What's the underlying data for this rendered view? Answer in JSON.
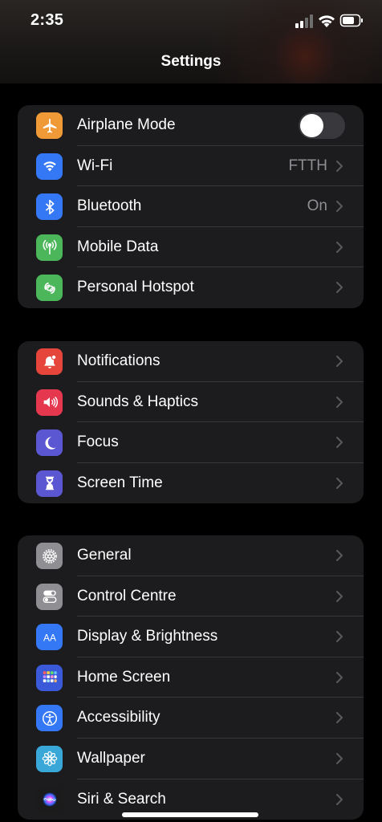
{
  "status": {
    "time": "2:35"
  },
  "header": {
    "title": "Settings"
  },
  "groups": [
    {
      "items": [
        {
          "label": "Airplane Mode",
          "icon": "airplane-icon",
          "color": "#f09a37",
          "toggle": false
        },
        {
          "label": "Wi-Fi",
          "value": "FTTH",
          "icon": "wifi-icon",
          "color": "#3478f6"
        },
        {
          "label": "Bluetooth",
          "value": "On",
          "icon": "bluetooth-icon",
          "color": "#3478f6"
        },
        {
          "label": "Mobile Data",
          "icon": "antenna-icon",
          "color": "#4cb75a"
        },
        {
          "label": "Personal Hotspot",
          "icon": "hotspot-icon",
          "color": "#4cb75a"
        }
      ]
    },
    {
      "items": [
        {
          "label": "Notifications",
          "icon": "notifications-icon",
          "color": "#e5453a"
        },
        {
          "label": "Sounds & Haptics",
          "icon": "speaker-icon",
          "color": "#e5384f"
        },
        {
          "label": "Focus",
          "icon": "moon-icon",
          "color": "#5b57d3"
        },
        {
          "label": "Screen Time",
          "icon": "hourglass-icon",
          "color": "#5b57d3"
        }
      ]
    },
    {
      "items": [
        {
          "label": "General",
          "icon": "gear-icon",
          "color": "#8e8e93"
        },
        {
          "label": "Control Centre",
          "icon": "switches-icon",
          "color": "#8e8e93"
        },
        {
          "label": "Display & Brightness",
          "icon": "text-size-icon",
          "color": "#3478f6"
        },
        {
          "label": "Home Screen",
          "icon": "app-grid-icon",
          "color": "#3a5ad9"
        },
        {
          "label": "Accessibility",
          "icon": "accessibility-icon",
          "color": "#3478f6"
        },
        {
          "label": "Wallpaper",
          "icon": "flower-icon",
          "color": "#39a8d9"
        },
        {
          "label": "Siri & Search",
          "icon": "siri-icon",
          "color": "#1b1b1b"
        }
      ]
    }
  ]
}
